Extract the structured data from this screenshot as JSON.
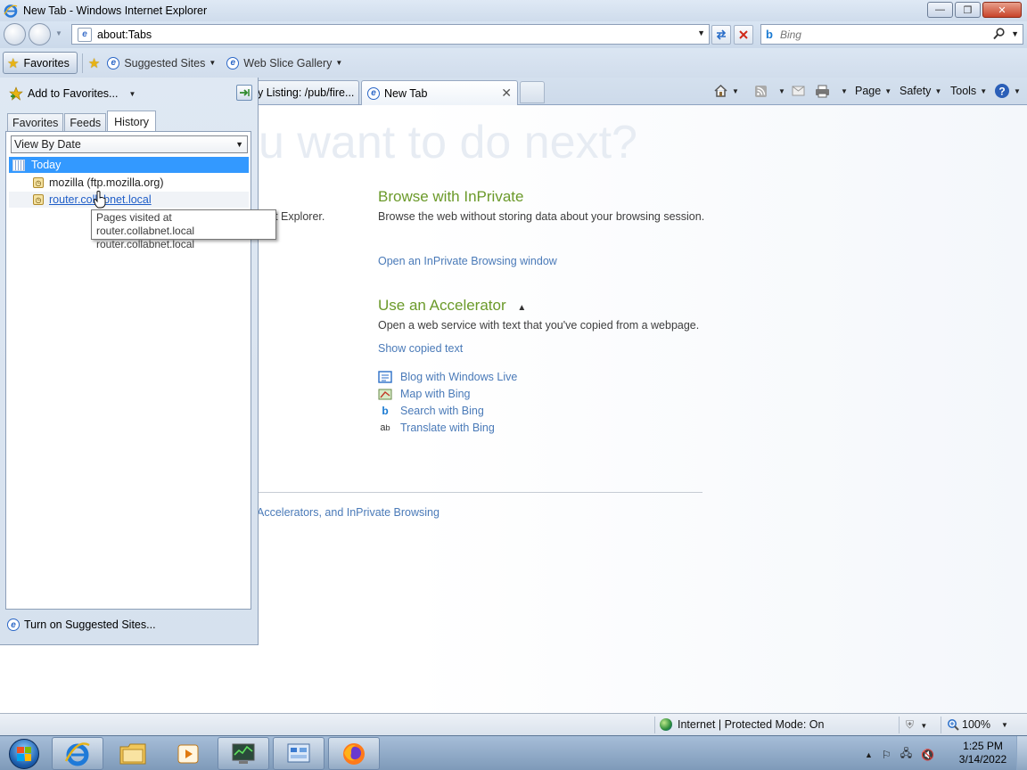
{
  "window": {
    "title": "New Tab - Windows Internet Explorer",
    "min_label": "—",
    "restore_label": "❐",
    "close_label": "✕"
  },
  "address_bar": {
    "url": "about:Tabs",
    "search_placeholder": "Bing"
  },
  "favorites_bar": {
    "favorites_label": "Favorites",
    "items": [
      {
        "label": "Suggested Sites"
      },
      {
        "label": "Web Slice Gallery"
      }
    ]
  },
  "tabs": [
    {
      "label": "y Listing: /pub/fire..."
    },
    {
      "label": "New Tab",
      "active": true
    }
  ],
  "command_bar": {
    "page_label": "Page",
    "safety_label": "Safety",
    "tools_label": "Tools"
  },
  "favorites_panel": {
    "add_label": "Add to Favorites...",
    "tabs": [
      "Favorites",
      "Feeds",
      "History"
    ],
    "active_tab": "History",
    "view_select": "View By Date",
    "group_label": "Today",
    "history": [
      {
        "label": "mozilla (ftp.mozilla.org)"
      },
      {
        "label": "router.collabnet.local"
      }
    ],
    "tooltip_line1": "Pages visited at router.collabnet.local",
    "tooltip_line2": "router.collabnet.local",
    "suggested_label": "Turn on Suggested Sites..."
  },
  "content": {
    "headline": "u want to do next?",
    "partial_text": "rnet Explorer.",
    "inprivate": {
      "title": "Browse with InPrivate",
      "text": "Browse the web without storing data about your browsing session.",
      "link": "Open an InPrivate Browsing window"
    },
    "accelerator": {
      "title": "Use an Accelerator",
      "text": "Open a web service with text that you've copied from a webpage.",
      "link": "Show copied text",
      "items": [
        {
          "label": "Blog with Windows Live",
          "icon": "blog-icon"
        },
        {
          "label": "Map with Bing",
          "icon": "map-icon"
        },
        {
          "label": "Search with Bing",
          "icon": "bing-icon"
        },
        {
          "label": "Translate with Bing",
          "icon": "translate-icon"
        }
      ]
    },
    "footer_link": "Accelerators, and InPrivate Browsing"
  },
  "status_bar": {
    "zone": "Internet | Protected Mode: On",
    "zoom": "100%"
  },
  "taskbar": {
    "time": "1:25 PM",
    "date": "3/14/2022"
  },
  "colors": {
    "accent_green": "#6b9a2a",
    "link_blue": "#4a7ab8",
    "selection_blue": "#3399ff"
  }
}
